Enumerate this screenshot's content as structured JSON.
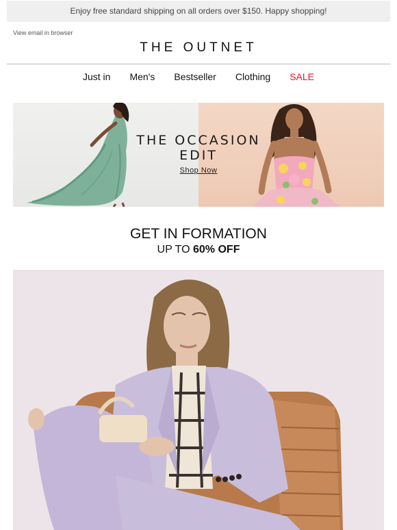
{
  "banner": {
    "text": "Enjoy free standard shipping on all orders over $150. Happy shopping!"
  },
  "header": {
    "view_in_browser": "View email in browser",
    "logo": "THE OUTNET"
  },
  "nav": {
    "items": [
      {
        "label": "Just in"
      },
      {
        "label": "Men's"
      },
      {
        "label": "Bestseller"
      },
      {
        "label": "Clothing"
      },
      {
        "label": "SALE",
        "color": "#e8161b"
      }
    ]
  },
  "hero": {
    "title_line1": "THE OCCASION",
    "title_line2": "EDIT",
    "cta": "Shop Now"
  },
  "promo": {
    "title": "GET IN FORMATION",
    "subtitle_prefix": "UP TO ",
    "subtitle_bold": "60% OFF"
  },
  "colors": {
    "sale": "#e8161b",
    "banner_bg": "#efefef",
    "suit_lavender": "#c9bddc",
    "chair_tan": "#b87a4b"
  }
}
